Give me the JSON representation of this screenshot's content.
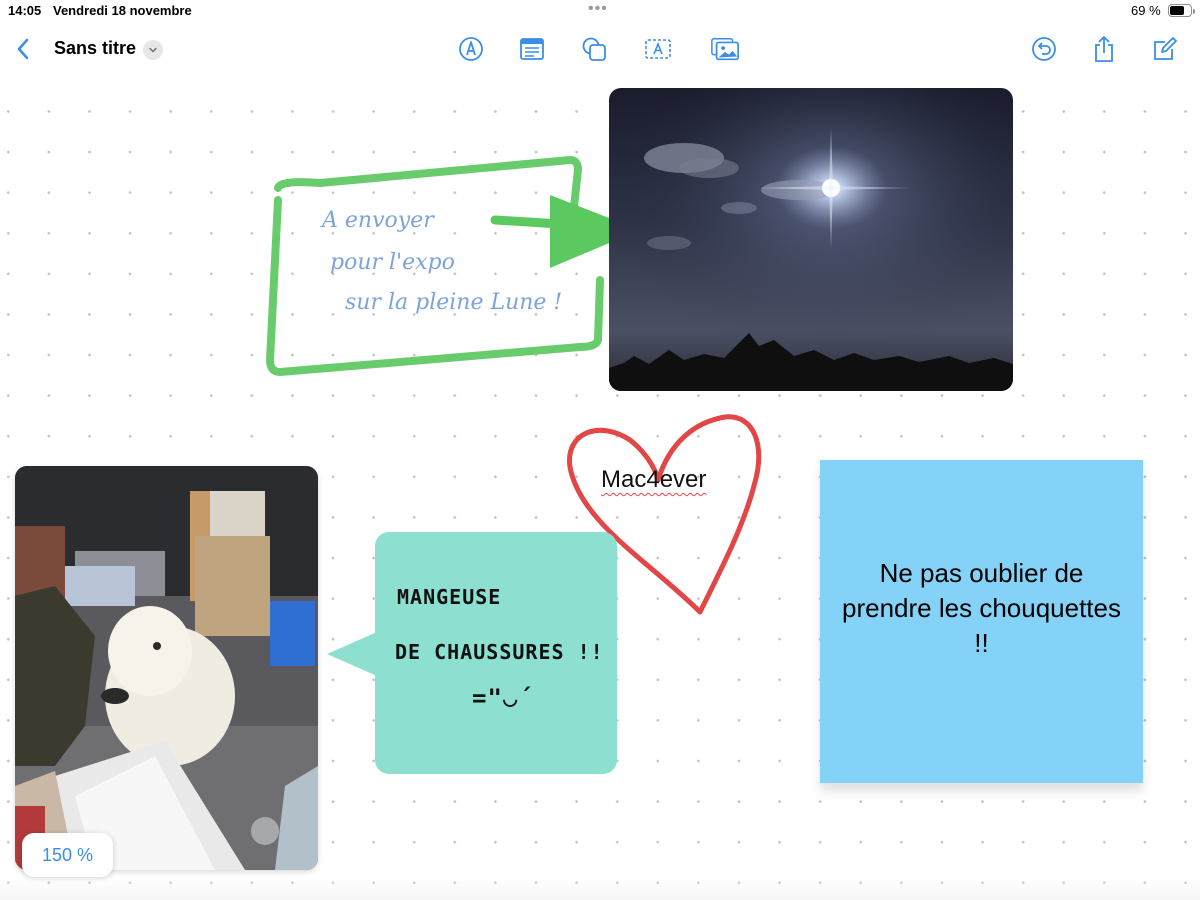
{
  "status_bar": {
    "time": "14:05",
    "date": "Vendredi 18 novembre",
    "dots": "•••",
    "battery_percent": "69 %",
    "battery_level": 0.69
  },
  "toolbar": {
    "title": "Sans titre",
    "accent_color": "#3a8ee6",
    "left_icons": [
      "chevron-left-icon",
      "chevron-down-icon"
    ],
    "center_icons": [
      "pen-icon",
      "text-box-icon",
      "shapes-icon",
      "text-icon",
      "media-icon"
    ],
    "right_icons": [
      "undo-icon",
      "share-icon",
      "compose-icon"
    ]
  },
  "canvas": {
    "handwritten_note": {
      "lines": [
        "A envoyer",
        "pour l'expo",
        "sur la pleine Lune !"
      ],
      "ink_color": "#7da2dd",
      "frame_color": "#5cc860"
    },
    "moon_photo": {
      "subject": "moon-night-sky"
    },
    "heart": {
      "label": "Mac4ever",
      "color": "#e03c3c"
    },
    "dog_photo": {
      "subject": "white-dog"
    },
    "speech_bubble": {
      "lines": [
        "MANGEUSE",
        "DE CHAUSSURES !!",
        "=\"◡´"
      ],
      "color": "#8de0cf"
    },
    "sticky_note": {
      "text": "Ne pas oublier de prendre les chouquettes !!",
      "color": "#84d2f7"
    }
  },
  "zoom": {
    "label": "150 %",
    "level_percent": 150
  }
}
